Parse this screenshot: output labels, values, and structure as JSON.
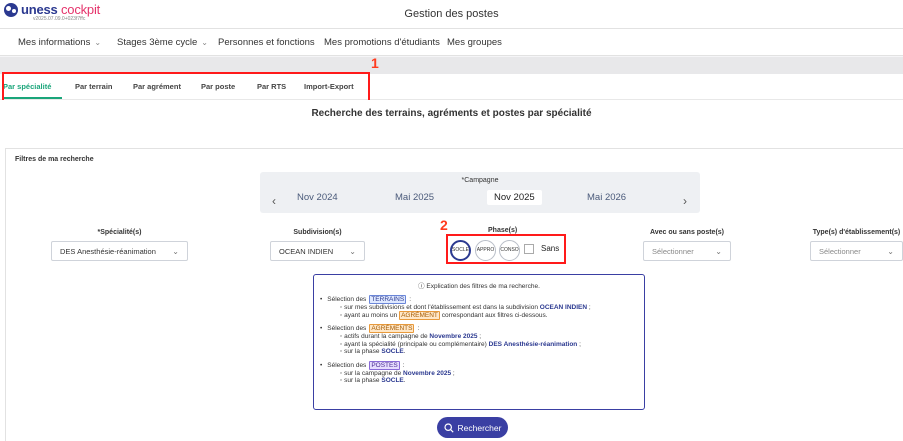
{
  "header": {
    "logo_brand": "uness",
    "logo_product": "cockpit",
    "version": "v2025.07.09.0+023f7ffc",
    "title": "Gestion des postes"
  },
  "nav": {
    "items": [
      {
        "label": "Mes informations",
        "has_menu": true
      },
      {
        "label": "Stages 3ème cycle",
        "has_menu": true
      },
      {
        "label": "Personnes et fonctions",
        "has_menu": false
      },
      {
        "label": "Mes promotions d'étudiants",
        "has_menu": false
      },
      {
        "label": "Mes groupes",
        "has_menu": false
      }
    ]
  },
  "tabs": {
    "items": [
      "Par spécialité",
      "Par terrain",
      "Par agrément",
      "Par poste",
      "Par RTS",
      "Import-Export"
    ],
    "active_index": 0
  },
  "annotations": {
    "one": "1",
    "two": "2"
  },
  "main": {
    "title": "Recherche des terrains, agréments et postes par spécialité",
    "filters_title": "Filtres de ma recherche"
  },
  "campaign": {
    "label": "*Campagne",
    "items": [
      "Nov 2024",
      "Mai 2025",
      "Nov 2025",
      "Mai 2026"
    ],
    "selected_index": 2,
    "prev": "‹",
    "next": "›"
  },
  "fields": {
    "specialite": {
      "label": "*Spécialité(s)",
      "value": "DES Anesthésie-réanimation"
    },
    "subdivision": {
      "label": "Subdivision(s)",
      "value": "OCEAN INDIEN"
    },
    "poste": {
      "label": "Avec ou sans poste(s)",
      "placeholder": "Sélectionner"
    },
    "etablissement": {
      "label": "Type(s) d'établissement(s)",
      "placeholder": "Sélectionner"
    }
  },
  "phase": {
    "label": "Phase(s)",
    "buttons": [
      "SOCLE",
      "APPRO",
      "CONSO"
    ],
    "active_index": 0,
    "sans_label": "Sans"
  },
  "explain": {
    "title": "ⓘ Explication des filtres de ma recherche.",
    "terrains": {
      "prefix": "Sélection des",
      "tag": "TERRAINS",
      "suffix": ":",
      "line1_pre": "sur mes subdivisions et dont l'établissement est dans la subdivision",
      "line1_val": "OCEAN INDIEN",
      "line1_post": ";",
      "line2_pre": "ayant au moins un",
      "line2_tag": "AGRÉMENT",
      "line2_post": "correspondant aux filtres ci-dessous."
    },
    "agrements": {
      "prefix": "Sélection des",
      "tag": "AGRÉMENTS",
      "suffix": ":",
      "line1_pre": "actifs durant la campagne de",
      "line1_val": "Novembre 2025",
      "line1_post": ";",
      "line2_pre": "ayant la spécialité (principale ou complémentaire)",
      "line2_val": "DES Anesthésie-réanimation",
      "line2_post": ";",
      "line3_pre": "sur la phase",
      "line3_val": "SOCLE",
      "line3_post": "."
    },
    "postes": {
      "prefix": "Sélection des",
      "tag": "POSTES",
      "suffix": ":",
      "line1_pre": "sur la campagne de",
      "line1_val": "Novembre 2025",
      "line1_post": ";",
      "line2_pre": "sur la phase",
      "line2_val": "SOCLE",
      "line2_post": "."
    }
  },
  "search_button": {
    "label": "Rechercher"
  },
  "colors": {
    "brand": "#2b3990",
    "active_tab": "#1aa57a",
    "annotation": "#ff1a1a"
  }
}
